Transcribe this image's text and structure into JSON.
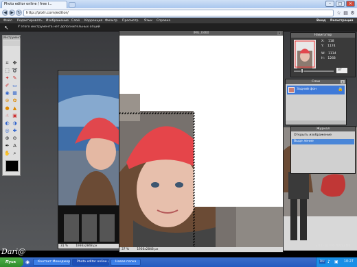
{
  "browser": {
    "tab_title": "Photo editor online / free i...",
    "url": "http://pixlr.com/editor/"
  },
  "menu": {
    "items": [
      "Файл",
      "Редактировать",
      "Изображение",
      "Слой",
      "Коррекция",
      "Фильтр",
      "Просмотр",
      "Язык",
      "Справка"
    ],
    "right": [
      "Вход",
      "Регистрация"
    ]
  },
  "hint": "У этого инструмента нет дополнительных опций",
  "tools": {
    "title": "Инструмент"
  },
  "document_main": {
    "title": "IMG_0460",
    "zoom": "37",
    "zoom_unit": "%",
    "size": "1936x2848 px"
  },
  "document_back": {
    "zoom": "31",
    "zoom_unit": "%",
    "size": "1936x2848 px"
  },
  "navigator": {
    "title": "Навигатор",
    "x_label": "X:",
    "x_value": "118",
    "y_label": "Y:",
    "y_value": "1174",
    "w_label": "W:",
    "w_value": "1114",
    "h_label": "H:",
    "h_value": "1268",
    "zoom": "37"
  },
  "layers": {
    "title": "Слои",
    "layer_name": "Задний фон"
  },
  "history": {
    "title": "Журнал",
    "items": [
      "Открыть изображение",
      "Выде ление"
    ]
  },
  "version": "v.8.7 - 61 FPS 28/292 MB",
  "watermark": "Dari@",
  "taskbar": {
    "start": "Пуск",
    "items": [
      "Контакт Менеджер",
      "Photo editor online / f...",
      "Новая папка"
    ],
    "lang": "RU",
    "time": "10:27"
  },
  "colors": {
    "accent_blue": "#3f7ad8",
    "history_selected": "#4a86d8",
    "taskbar": "#245bc0"
  }
}
